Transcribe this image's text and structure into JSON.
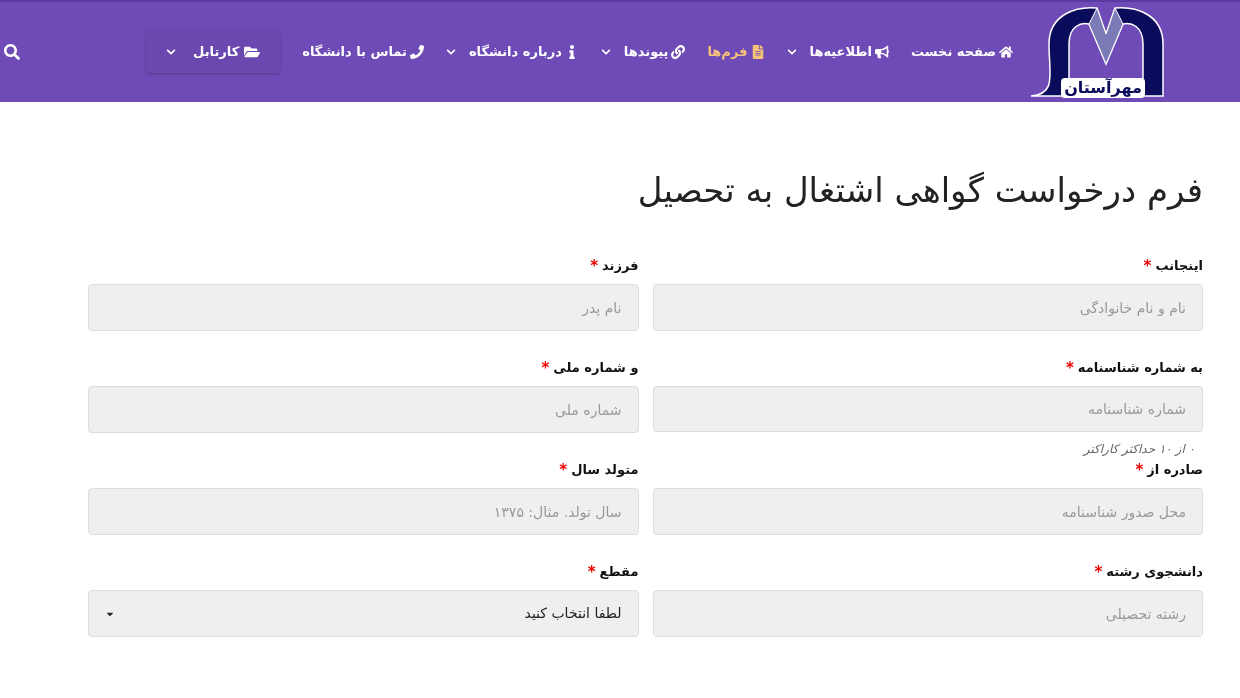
{
  "header": {
    "logo_text": "مهرآستان",
    "nav": [
      {
        "label": "صفحه نخست",
        "dropdown": false,
        "selected": false
      },
      {
        "label": "اطلاعیه‌ها",
        "dropdown": true,
        "selected": false
      },
      {
        "label": "فرم‌ها",
        "dropdown": false,
        "selected": true
      },
      {
        "label": "پیوندها",
        "dropdown": true,
        "selected": false
      },
      {
        "label": "درباره دانشگاه",
        "dropdown": true,
        "selected": false
      },
      {
        "label": "تماس با دانشگاه",
        "dropdown": false,
        "selected": false
      }
    ],
    "portal_button": {
      "label": "کارتابل"
    }
  },
  "title": "فرم درخواست گواهی اشتغال به تحصیل",
  "fields": [
    {
      "kind": "text",
      "label": "اینجانب",
      "mark": "*",
      "placeholder": "نام و نام خانوادگی"
    },
    {
      "kind": "text",
      "label": "فرزند",
      "mark": "*",
      "placeholder": "نام پدر"
    },
    {
      "kind": "text",
      "label": "به شماره شناسنامه",
      "mark": "*",
      "placeholder": "شماره شناسنامه",
      "helper": "۰ از ۱۰ حداکثر کاراکتر"
    },
    {
      "kind": "text",
      "label": "و شماره ملی",
      "mark": "*",
      "placeholder": "شماره ملی"
    },
    {
      "kind": "text",
      "label": "صادره از",
      "mark": "*",
      "placeholder": "محل صدور شناسنامه"
    },
    {
      "kind": "text",
      "label": "متولد سال",
      "mark": "*",
      "placeholder": "سال تولد. مثال: ۱۳۷۵"
    },
    {
      "kind": "text",
      "label": "دانشجوی رشته",
      "mark": "*",
      "placeholder": "رشته تحصیلی"
    },
    {
      "kind": "select",
      "label": "مقطع",
      "mark": "*",
      "value": "لطفا انتخاب کنید"
    }
  ]
}
